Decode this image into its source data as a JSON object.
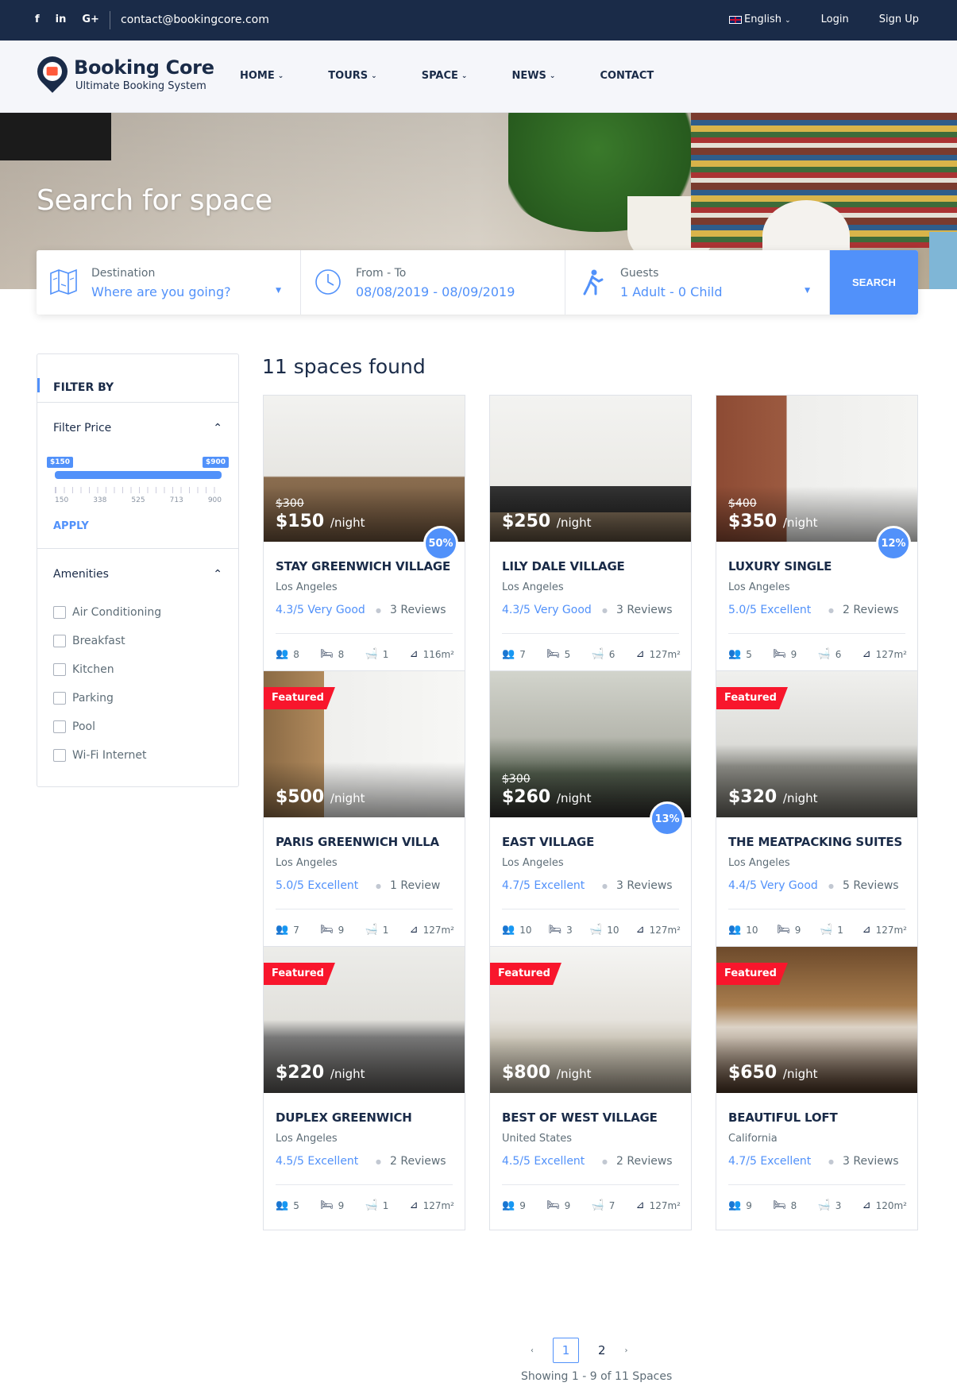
{
  "topbar": {
    "social": [
      "f",
      "in",
      "G+"
    ],
    "email": "contact@bookingcore.com",
    "language": "English",
    "login": "Login",
    "signup": "Sign Up"
  },
  "header": {
    "brand": "Booking Core",
    "tagline": "Ultimate Booking System",
    "nav": [
      {
        "label": "HOME",
        "has_dropdown": true
      },
      {
        "label": "TOURS",
        "has_dropdown": true
      },
      {
        "label": "SPACE",
        "has_dropdown": true
      },
      {
        "label": "NEWS",
        "has_dropdown": true
      },
      {
        "label": "CONTACT",
        "has_dropdown": false
      }
    ]
  },
  "hero": {
    "title": "Search for space"
  },
  "search": {
    "destination": {
      "label": "Destination",
      "value": "Where are you going?",
      "icon": "map-icon"
    },
    "dates": {
      "label": "From - To",
      "value": "08/08/2019 - 08/09/2019",
      "icon": "clock-icon"
    },
    "guests": {
      "label": "Guests",
      "value": "1 Adult - 0 Child",
      "icon": "guest-icon"
    },
    "button": "SEARCH"
  },
  "filters": {
    "title": "FILTER BY",
    "price": {
      "title": "Filter Price",
      "min_tag": "$150",
      "max_tag": "$900",
      "ticks": [
        "150",
        "338",
        "525",
        "713",
        "900"
      ],
      "apply": "APPLY"
    },
    "amenities": {
      "title": "Amenities",
      "items": [
        "Air Conditioning",
        "Breakfast",
        "Kitchen",
        "Parking",
        "Pool",
        "Wi-Fi Internet"
      ]
    }
  },
  "results": {
    "count_text": "11 spaces found",
    "cards": [
      {
        "name": "STAY GREENWICH VILLAGE",
        "location": "Los Angeles",
        "old_price": "$300",
        "price": "$150",
        "per": "/night",
        "discount": "50%",
        "featured": "",
        "rating": "4.3/5 Very Good",
        "reviews": "3 Reviews",
        "guests": "8",
        "beds": "8",
        "baths": "1",
        "area": "116m²"
      },
      {
        "name": "LILY DALE VILLAGE",
        "location": "Los Angeles",
        "old_price": "",
        "price": "$250",
        "per": "/night",
        "discount": "",
        "featured": "",
        "rating": "4.3/5 Very Good",
        "reviews": "3 Reviews",
        "guests": "7",
        "beds": "5",
        "baths": "6",
        "area": "127m²"
      },
      {
        "name": "LUXURY SINGLE",
        "location": "Los Angeles",
        "old_price": "$400",
        "price": "$350",
        "per": "/night",
        "discount": "12%",
        "featured": "",
        "rating": "5.0/5 Excellent",
        "reviews": "2 Reviews",
        "guests": "5",
        "beds": "9",
        "baths": "6",
        "area": "127m²"
      },
      {
        "name": "PARIS GREENWICH VILLA",
        "location": "Los Angeles",
        "old_price": "",
        "price": "$500",
        "per": "/night",
        "discount": "",
        "featured": "Featured",
        "rating": "5.0/5 Excellent",
        "reviews": "1 Review",
        "guests": "7",
        "beds": "9",
        "baths": "1",
        "area": "127m²"
      },
      {
        "name": "EAST VILLAGE",
        "location": "Los Angeles",
        "old_price": "$300",
        "price": "$260",
        "per": "/night",
        "discount": "13%",
        "featured": "",
        "rating": "4.7/5 Excellent",
        "reviews": "3 Reviews",
        "guests": "10",
        "beds": "3",
        "baths": "10",
        "area": "127m²"
      },
      {
        "name": "THE MEATPACKING SUITES",
        "location": "Los Angeles",
        "old_price": "",
        "price": "$320",
        "per": "/night",
        "discount": "",
        "featured": "Featured",
        "rating": "4.4/5 Very Good",
        "reviews": "5 Reviews",
        "guests": "10",
        "beds": "9",
        "baths": "1",
        "area": "127m²"
      },
      {
        "name": "DUPLEX GREENWICH",
        "location": "Los Angeles",
        "old_price": "",
        "price": "$220",
        "per": "/night",
        "discount": "",
        "featured": "Featured",
        "rating": "4.5/5 Excellent",
        "reviews": "2 Reviews",
        "guests": "5",
        "beds": "9",
        "baths": "1",
        "area": "127m²"
      },
      {
        "name": "BEST OF WEST VILLAGE",
        "location": "United States",
        "old_price": "",
        "price": "$800",
        "per": "/night",
        "discount": "",
        "featured": "Featured",
        "rating": "4.5/5 Excellent",
        "reviews": "2 Reviews",
        "guests": "9",
        "beds": "9",
        "baths": "7",
        "area": "127m²"
      },
      {
        "name": "BEAUTIFUL LOFT",
        "location": "California",
        "old_price": "",
        "price": "$650",
        "per": "/night",
        "discount": "",
        "featured": "Featured",
        "rating": "4.7/5 Excellent",
        "reviews": "3 Reviews",
        "guests": "9",
        "beds": "8",
        "baths": "3",
        "area": "120m²"
      }
    ]
  },
  "pagination": {
    "prev": "‹",
    "pages": [
      "1",
      "2"
    ],
    "next": "›",
    "showing": "Showing 1 - 9 of 11 Spaces"
  }
}
